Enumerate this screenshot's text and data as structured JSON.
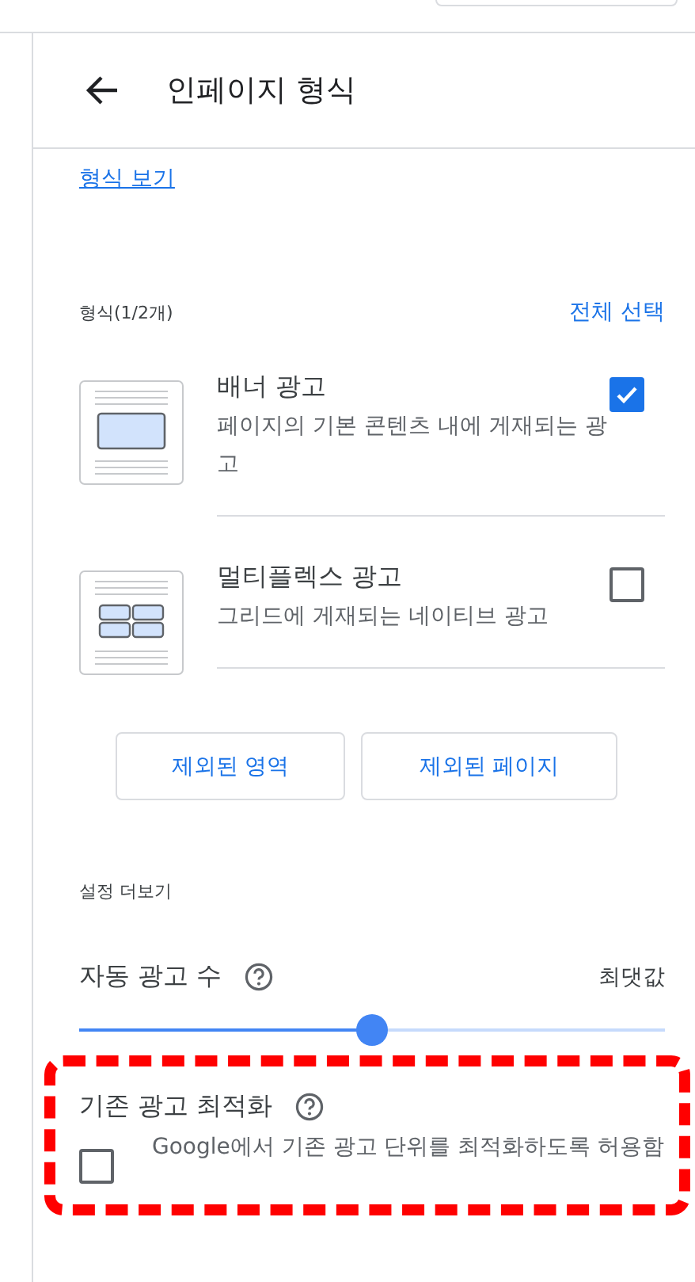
{
  "header": {
    "title": "인페이지 형식"
  },
  "link": "형식 보기",
  "formats": {
    "label": "형식(1/2개)",
    "select_all": "전체 선택",
    "items": [
      {
        "kind": "banner",
        "title": "배너 광고",
        "description": "페이지의 기본 콘텐츠 내에 게재되는 광고",
        "checked": true
      },
      {
        "kind": "multiplex",
        "title": "멀티플렉스 광고",
        "description": "그리드에 게재되는 네이티브 광고",
        "checked": false
      }
    ]
  },
  "buttons": [
    "제외된 영역",
    "제외된 페이지"
  ],
  "more_settings": {
    "label": "설정 더보기",
    "ad_count": {
      "label": "자동 광고 수",
      "reading": "최댓값",
      "level": 0.5
    },
    "optimize": {
      "label": "기존 광고 최적화",
      "option": "Google에서 기존 광고 단위를 최적화하도록 허용함",
      "checked": false
    }
  }
}
